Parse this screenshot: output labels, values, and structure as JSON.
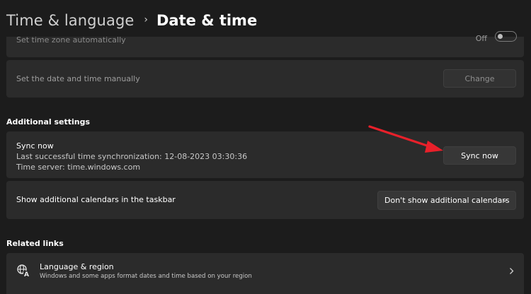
{
  "header": {
    "parent": "Time & language",
    "separator": "›",
    "current": "Date & time"
  },
  "time_zone_auto": {
    "label": "Set time zone automatically",
    "state_text": "Off",
    "checked": false
  },
  "manual_time": {
    "label": "Set the date and time manually",
    "button": "Change"
  },
  "additional_settings": {
    "heading": "Additional settings",
    "sync": {
      "title": "Sync now",
      "last_sync": "Last successful time synchronization: 12-08-2023 03:30:36",
      "server": "Time server: time.windows.com",
      "button": "Sync now"
    },
    "calendars": {
      "label": "Show additional calendars in the taskbar",
      "selected": "Don't show additional calendars"
    }
  },
  "related_links": {
    "heading": "Related links",
    "items": [
      {
        "title": "Language & region",
        "subtitle": "Windows and some apps format dates and time based on your region",
        "icon": "language-region-icon"
      }
    ]
  },
  "annotation": {
    "arrow_color": "#e8202a"
  }
}
